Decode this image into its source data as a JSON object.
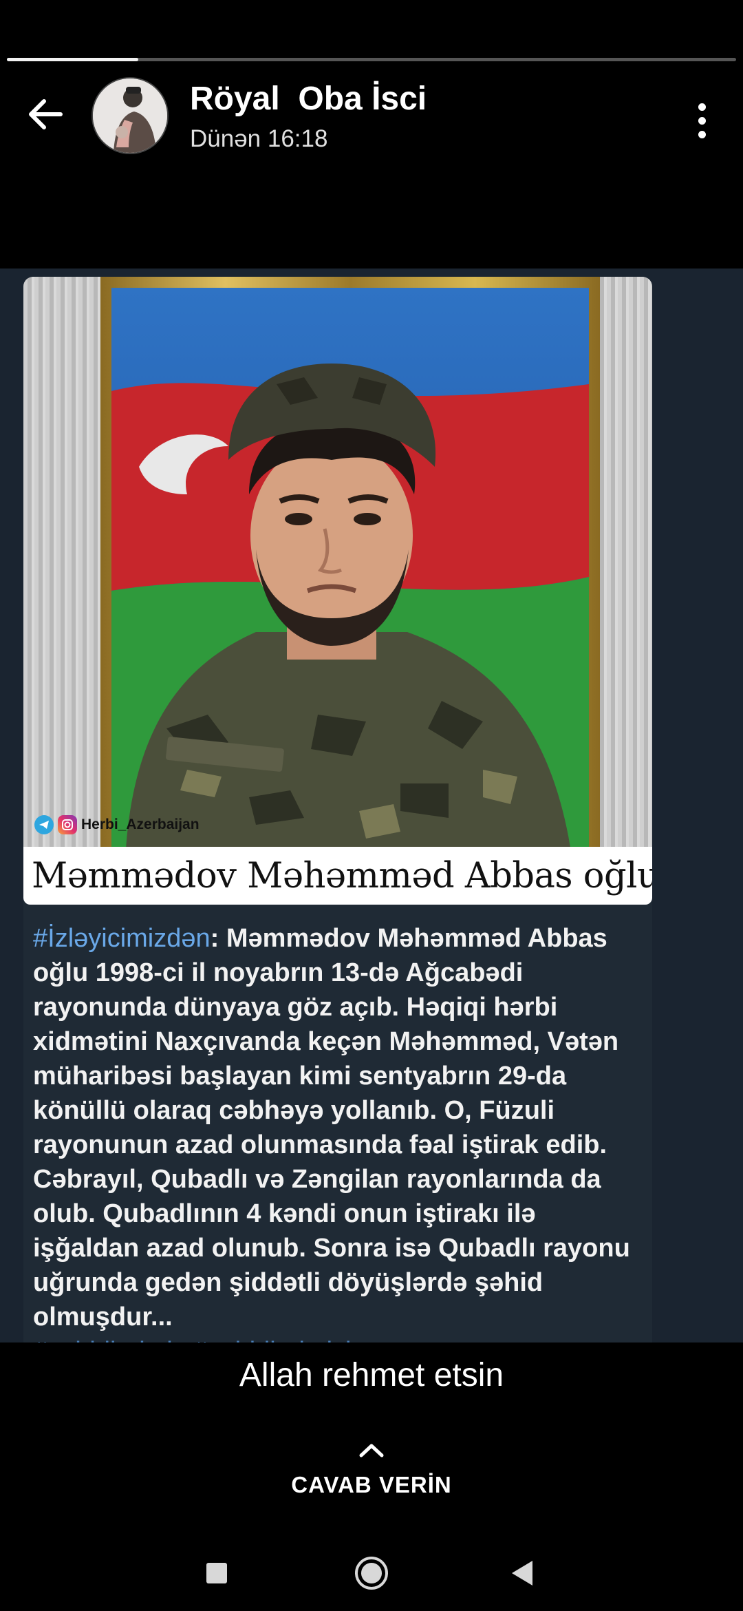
{
  "story": {
    "progress": 0.18
  },
  "header": {
    "user_name": "Röyal  Oba İsci",
    "time": "Dünən 16:18"
  },
  "post": {
    "photo_caption": "Məmmədov Məhəmməd Abbas oğlu",
    "watermark": "Herbi_Azerbaijan",
    "hashtag": "#İzləyicimizdən",
    "body": ": Məmmədov Məhəmməd Abbas oğlu 1998-ci il noyabrın 13-də Ağcabədi rayonunda dünyaya göz açıb. Həqiqi hərbi xidmətini Naxçıvanda keçən Məhəmməd, Vətən müharibəsi başlayan kimi sentyabrın 29-da könüllü olaraq cəbhəyə yollanıb. O, Füzuli rayonunun azad olunmasında fəal iştirak edib. Cəbrayıl, Qubadlı və Zəngilan rayonlarında da olub. Qubadlının 4 kəndi onun iştirakı ilə işğaldan azad olunub. Sonra isə Qubadlı rayonu uğrunda gedən şiddətli döyüşlərdə şəhid olmuşdur...",
    "tags": "#şəhidlərimiz #şəhidlərimizitanıyaq"
  },
  "reply": {
    "text": "Allah rehmet etsin",
    "button_label": "CAVAB VERİN"
  },
  "colors": {
    "background": "#000000",
    "post_background": "#1a2430",
    "hashtag": "#6aa8e8"
  },
  "icons": {
    "back": "arrow-left-icon",
    "menu": "more-vertical-icon",
    "reply": "chevron-up-icon",
    "nav": [
      "square-icon",
      "circle-icon",
      "triangle-back-icon"
    ]
  }
}
